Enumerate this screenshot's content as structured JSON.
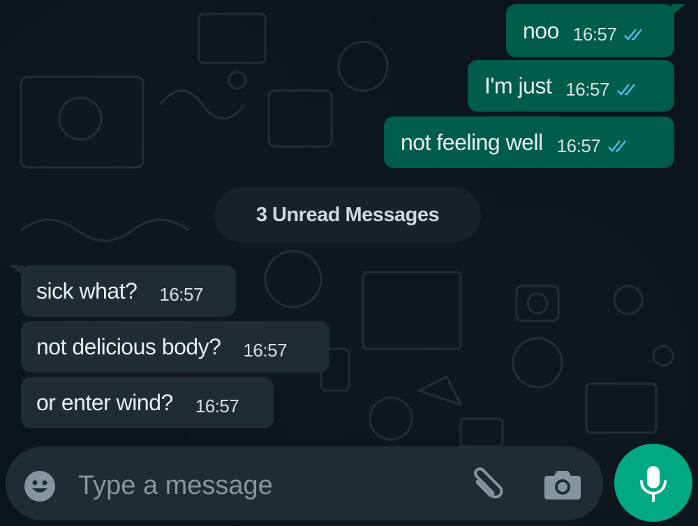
{
  "outgoing": [
    {
      "text": "noo",
      "time": "16:57",
      "status_icon": "double-check-read-icon"
    },
    {
      "text": "I'm just",
      "time": "16:57",
      "status_icon": "double-check-read-icon"
    },
    {
      "text": "not feeling well",
      "time": "16:57",
      "status_icon": "double-check-read-icon"
    }
  ],
  "unread_divider": "3 Unread Messages",
  "incoming": [
    {
      "text": "sick what?",
      "time": "16:57"
    },
    {
      "text": "not delicious body?",
      "time": "16:57"
    },
    {
      "text": "or enter wind?",
      "time": "16:57"
    }
  ],
  "composer": {
    "placeholder": "Type a message",
    "emoji_icon": "emoji-icon",
    "attach_icon": "paperclip-icon",
    "camera_icon": "camera-icon",
    "mic_icon": "microphone-icon"
  },
  "colors": {
    "background": "#0b141a",
    "outgoing_bubble": "#005c4b",
    "incoming_bubble": "#202c33",
    "accent": "#00a884",
    "read_ticks": "#53bdeb"
  }
}
